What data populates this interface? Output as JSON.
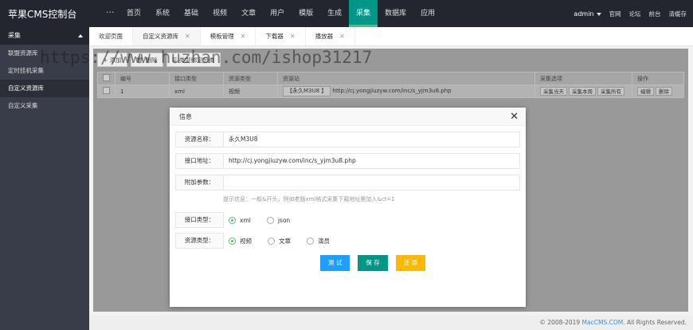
{
  "app": {
    "title": "苹果CMS控制台",
    "more_label": "···"
  },
  "top_nav": [
    "首页",
    "系统",
    "基础",
    "视频",
    "文章",
    "用户",
    "模版",
    "生成",
    "采集",
    "数据库",
    "应用"
  ],
  "top_nav_active": "采集",
  "top_right": {
    "user": "admin",
    "links": [
      "官网",
      "论坛",
      "前台",
      "清缓存"
    ]
  },
  "sidebar": {
    "group": "采集",
    "items": [
      "联盟资源库",
      "定时挂机采集",
      "自定义资源库",
      "自定义采集"
    ],
    "active": "自定义资源库"
  },
  "tabs": [
    {
      "label": "欢迎页面",
      "closable": false
    },
    {
      "label": "自定义资源库",
      "closable": true
    },
    {
      "label": "模板管理",
      "closable": true
    },
    {
      "label": "下载器",
      "closable": true
    },
    {
      "label": "播放器",
      "closable": true
    }
  ],
  "toolbar": {
    "add": "添加",
    "delete": "删除",
    "bind": "类型绑定分类"
  },
  "table": {
    "headers": [
      "编号",
      "接口类型",
      "资源类型",
      "资源站",
      "采集选项",
      "操作"
    ],
    "rows": [
      {
        "id": "1",
        "api_type": "xml",
        "res_type": "视频",
        "site_name": "【永久M3U8 】",
        "site_url": "http://cj.yongjiuzyw.com/inc/s_yjm3u8.php",
        "collect_options": [
          "采集当天",
          "采集本周",
          "采集所有"
        ],
        "actions": [
          "编辑",
          "删除"
        ]
      }
    ]
  },
  "modal": {
    "title": "信息",
    "fields": {
      "name_label": "资源名称：",
      "name_value": "永久M3U8",
      "url_label": "接口地址：",
      "url_value": "http://cj.yongjiuzyw.com/inc/s_yjm3u8.php",
      "param_label": "附加参数：",
      "param_value": "",
      "tip": "提示信息：一般&开头，例如老版xml格式采集下载地址需加入&ct=1",
      "api_type_label": "接口类型：",
      "api_type_options": [
        "xml",
        "json"
      ],
      "api_type_selected": "xml",
      "res_type_label": "资源类型：",
      "res_type_options": [
        "视频",
        "文章",
        "演员"
      ],
      "res_type_selected": "视频"
    },
    "buttons": {
      "test": "测 试",
      "save": "保 存",
      "reset": "还 原"
    },
    "colors": {
      "test": "#1e9fff",
      "save": "#009688",
      "reset": "#ffb800"
    }
  },
  "watermark": "https://www.huzhan.com/ishop31217",
  "footer": {
    "copyright": "© 2008-2019",
    "brand": "MacCMS.COM",
    "rights": ". All Rights Reserved."
  }
}
